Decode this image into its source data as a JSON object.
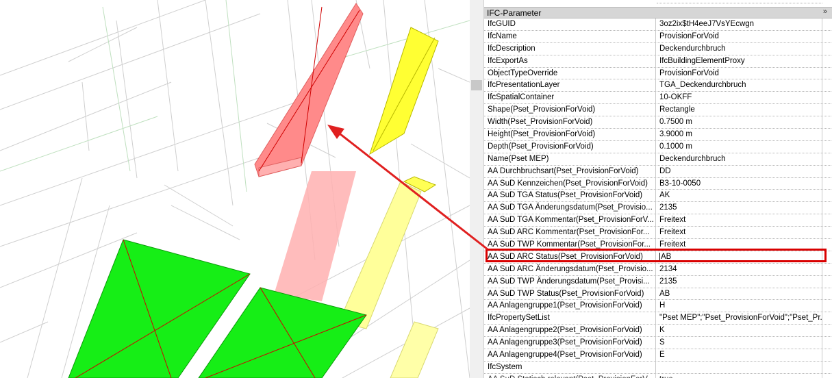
{
  "panel": {
    "section_title": "IFC-Parameter",
    "collapse_glyph": "»",
    "rows": [
      {
        "key": "IfcGUID",
        "value": "3oz2ix$tH4eeJ7VsYEcwgn"
      },
      {
        "key": "IfcName",
        "value": "ProvisionForVoid"
      },
      {
        "key": "IfcDescription",
        "value": "Deckendurchbruch"
      },
      {
        "key": "IfcExportAs",
        "value": "IfcBuildingElementProxy"
      },
      {
        "key": "ObjectTypeOverride",
        "value": "ProvisionForVoid"
      },
      {
        "key": "IfcPresentationLayer",
        "value": "TGA_Deckendurchbruch"
      },
      {
        "key": "IfcSpatialContainer",
        "value": "10-OKFF"
      },
      {
        "key": "Shape(Pset_ProvisionForVoid)",
        "value": "Rectangle"
      },
      {
        "key": "Width(Pset_ProvisionForVoid)",
        "value": "0.7500 m"
      },
      {
        "key": "Height(Pset_ProvisionForVoid)",
        "value": "3.9000 m"
      },
      {
        "key": "Depth(Pset_ProvisionForVoid)",
        "value": "0.1000 m"
      },
      {
        "key": "Name(Pset MEP)",
        "value": "Deckendurchbruch"
      },
      {
        "key": "AA Durchbruchsart(Pset_ProvisionForVoid)",
        "value": "DD"
      },
      {
        "key": "AA SuD Kennzeichen(Pset_ProvisionForVoid)",
        "value": "B3-10-0050"
      },
      {
        "key": "AA SuD TGA Status(Pset_ProvisionForVoid)",
        "value": "AK"
      },
      {
        "key": "AA SuD TGA Änderungsdatum(Pset_Provisio...",
        "value": "2135"
      },
      {
        "key": "AA SuD TGA Kommentar(Pset_ProvisionForV...",
        "value": "Freitext"
      },
      {
        "key": "AA SuD ARC Kommentar(Pset_ProvisionFor...",
        "value": "Freitext"
      },
      {
        "key": "AA SuD TWP Kommentar(Pset_ProvisionFor...",
        "value": "Freitext"
      },
      {
        "key": "AA SuD ARC Status(Pset_ProvisionForVoid)",
        "value": "AB"
      },
      {
        "key": "AA SuD ARC Änderungsdatum(Pset_Provisio...",
        "value": "2134"
      },
      {
        "key": "AA SuD TWP Änderungsdatum(Pset_Provisi...",
        "value": "2135"
      },
      {
        "key": "AA SuD TWP Status(Pset_ProvisionForVoid)",
        "value": "AB"
      },
      {
        "key": "AA Anlagengruppe1(Pset_ProvisionForVoid)",
        "value": "H"
      },
      {
        "key": "IfcPropertySetList",
        "value": "\"Pset MEP\";\"Pset_ProvisionForVoid\";\"Pset_Pr..."
      },
      {
        "key": "AA Anlagengruppe2(Pset_ProvisionForVoid)",
        "value": "K"
      },
      {
        "key": "AA Anlagengruppe3(Pset_ProvisionForVoid)",
        "value": "S"
      },
      {
        "key": "AA Anlagengruppe4(Pset_ProvisionForVoid)",
        "value": "E"
      },
      {
        "key": "IfcSystem",
        "value": ""
      },
      {
        "key": "AA SuD Statisch relevant(Pset_ProvisionForV...",
        "value": "true"
      }
    ],
    "highlight_key": "AA SuD ARC Status(Pset_ProvisionForVoid)"
  },
  "colors": {
    "highlight_box": "#d90000",
    "annotation_arrow": "#e02020",
    "selected_void": "#ff7070",
    "void_yellow": "#ffff33",
    "void_green": "#00ee00"
  }
}
